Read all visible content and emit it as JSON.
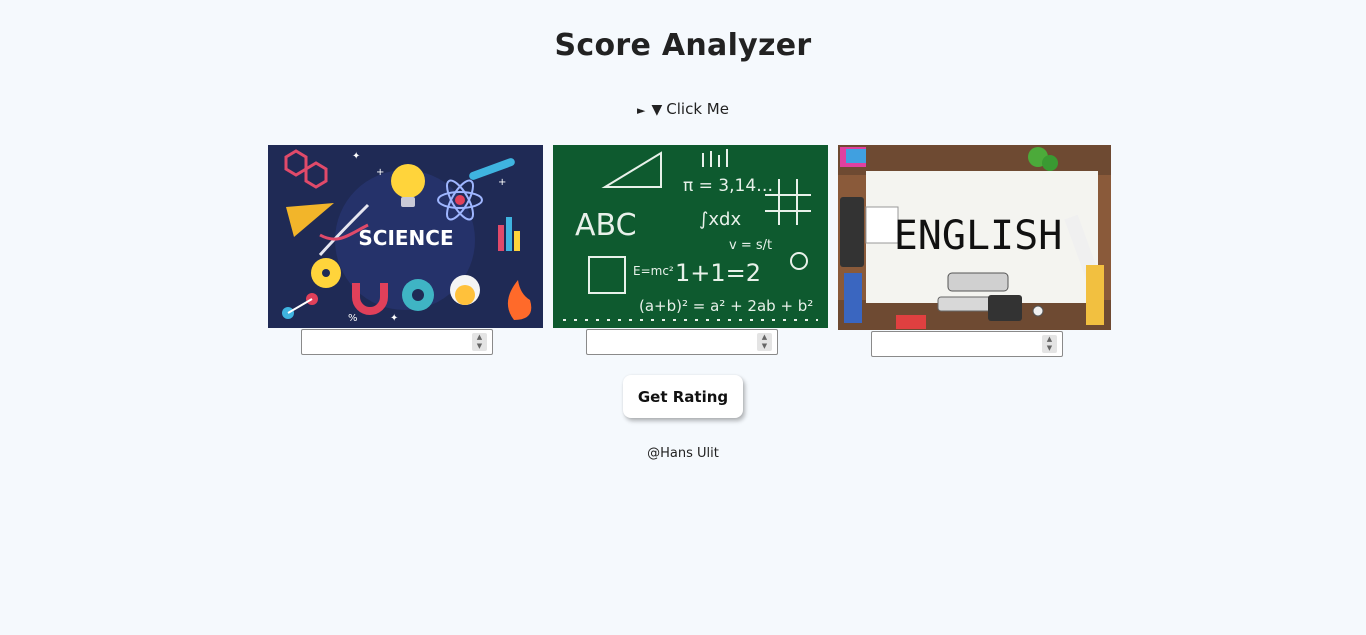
{
  "header": {
    "title": "Score Analyzer"
  },
  "toggle": {
    "marker": "►",
    "caret": "▼",
    "label": "Click Me"
  },
  "subjects": [
    {
      "name": "SCIENCE",
      "value": ""
    },
    {
      "name": "ABC",
      "value": ""
    },
    {
      "name": "ENGLISH",
      "value": ""
    }
  ],
  "math_board": {
    "pi": "π = 3,14…",
    "integral": "∫xdx",
    "emc": "E=mc²",
    "sum": "1+1=2",
    "v": "v = s/t",
    "binomial": "(a+b)² = a² + 2ab + b²"
  },
  "actions": {
    "rating_label": "Get Rating"
  },
  "footer": {
    "credit": "@Hans Ulit"
  },
  "colors": {
    "background": "#f5f9fd",
    "science_bg": "#1f2a55",
    "chalkboard": "#0e5a2f",
    "english_board": "#f4f4f0"
  }
}
